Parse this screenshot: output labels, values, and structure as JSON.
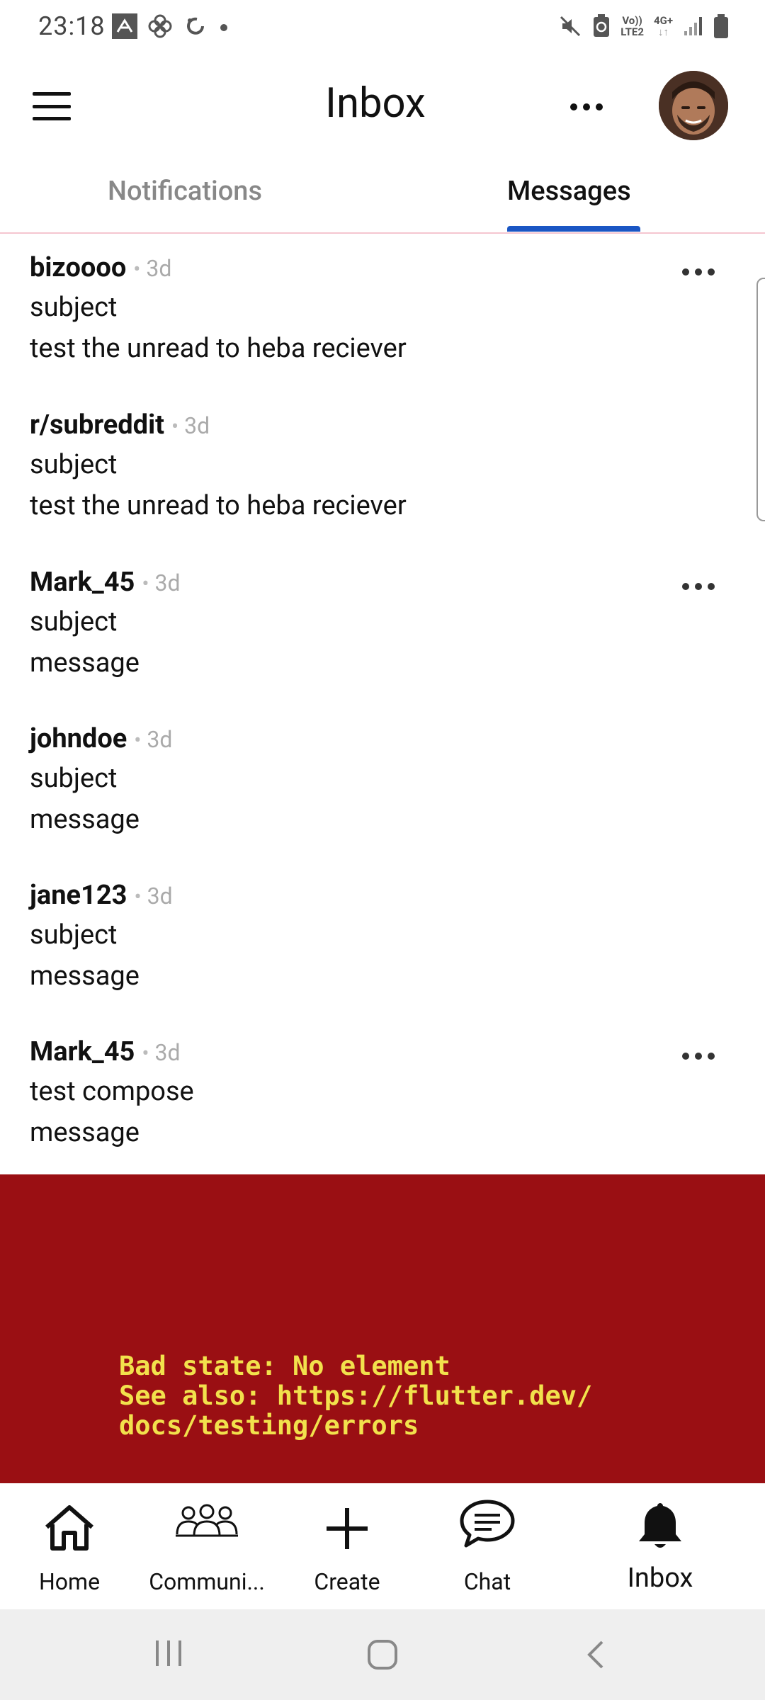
{
  "status_bar": {
    "time": "23:18",
    "left_icons": [
      "notification-icon",
      "pinwheel-icon",
      "sync-icon",
      "dot-icon"
    ],
    "right_icons": [
      "mute-icon",
      "battery-saver-icon",
      "volte-icon",
      "signal-4g-icon",
      "signal-bars-icon",
      "battery-icon"
    ],
    "network_top": "Vo))",
    "network_bottom": "LTE2",
    "data_label": "4G+"
  },
  "app_bar": {
    "title": "Inbox",
    "menu_icon": "hamburger-menu-icon",
    "more_icon": "more-horizontal-icon"
  },
  "tabs": [
    {
      "label": "Notifications",
      "active": false
    },
    {
      "label": "Messages",
      "active": true
    }
  ],
  "messages": [
    {
      "sender": "bizoooo",
      "time": "3d",
      "subject": "subject",
      "body": "test the unread to heba reciever",
      "has_more": true
    },
    {
      "sender": "r/subreddit",
      "time": "3d",
      "subject": "subject",
      "body": "test the unread to heba reciever",
      "has_more": false
    },
    {
      "sender": "Mark_45",
      "time": "3d",
      "subject": "subject",
      "body": "message",
      "has_more": true
    },
    {
      "sender": "johndoe",
      "time": "3d",
      "subject": "subject",
      "body": "message",
      "has_more": false
    },
    {
      "sender": "jane123",
      "time": "3d",
      "subject": "subject",
      "body": "message",
      "has_more": false
    },
    {
      "sender": "Mark_45",
      "time": "3d",
      "subject": "test compose",
      "body": "message",
      "has_more": true
    }
  ],
  "separator": "•",
  "error": {
    "line1": "Bad state: No element",
    "line2": "See also: https://flutter.dev/",
    "line3": "docs/testing/errors",
    "background": "#9a0f13",
    "text_color": "#f2e14c"
  },
  "bottom_nav": [
    {
      "label": "Home",
      "icon": "home-icon",
      "active": false
    },
    {
      "label": "Communi...",
      "icon": "communities-icon",
      "active": false
    },
    {
      "label": "Create",
      "icon": "plus-icon",
      "active": false
    },
    {
      "label": "Chat",
      "icon": "chat-icon",
      "active": false
    },
    {
      "label": "Inbox",
      "icon": "bell-icon",
      "active": true
    }
  ],
  "system_nav": [
    "recents-icon",
    "home-circle-icon",
    "back-icon"
  ],
  "colors": {
    "accent": "#1a56c4",
    "muted_text": "#888888",
    "divider": "#f5c6d0"
  }
}
